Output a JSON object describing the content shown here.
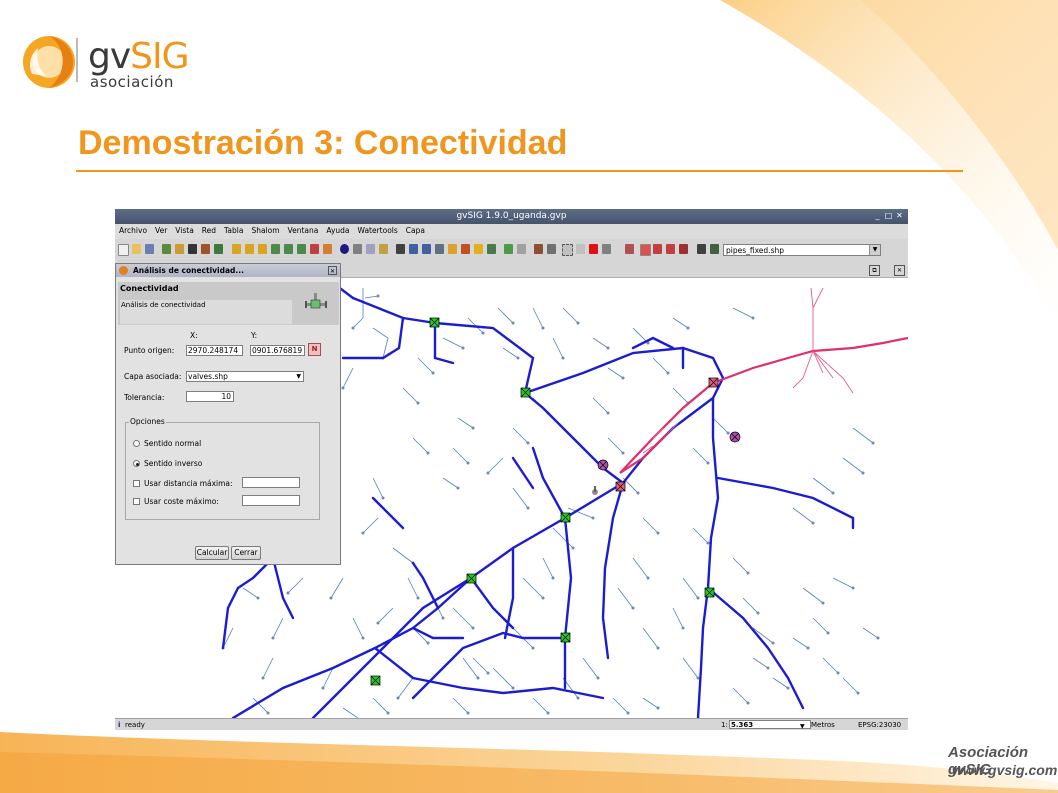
{
  "slide": {
    "logo_brand_prefix": "gv",
    "logo_brand_suffix": "SIG",
    "logo_subtitle": "asociación",
    "title": "Demostración 3: Conectividad",
    "footer_org": "Asociación gvSIG",
    "footer_url": "www.gvsig.com",
    "colors": {
      "accent": "#f0961e",
      "pipe": "#1c1cd0",
      "selected_pipe": "#e0306a",
      "valve": "#22cc22"
    }
  },
  "app": {
    "window_title": "gvSIG 1.9.0_uganda.gvp",
    "menu": [
      "Archivo",
      "Ver",
      "Vista",
      "Red",
      "Tabla",
      "Shalom",
      "Ventana",
      "Ayuda",
      "Watertools",
      "Capa"
    ],
    "layer_combo_value": "pipes_fixed.shp",
    "status_text": "ready",
    "scale_prefix": "1:",
    "scale_value": "5.363",
    "units": "Metros",
    "crs": "EPSG:23030"
  },
  "dialog": {
    "window_title": "Análisis de conectividad...",
    "header_title": "Conectividad",
    "header_desc": "Análisis de conectividad",
    "x_label": "X:",
    "y_label": "Y:",
    "origin_label": "Punto origen:",
    "origin_x": "2970.248174",
    "origin_y": "0901.676819",
    "layer_label": "Capa asociada:",
    "layer_value": "valves.shp",
    "tolerance_label": "Tolerancia:",
    "tolerance_value": "10",
    "options_title": "Opciones",
    "radio_normal": "Sentido normal",
    "radio_inverse": "Sentido inverso",
    "check_distance": "Usar distancia máxima:",
    "check_cost": "Usar coste máximo:",
    "calc_button": "Calcular",
    "close_button": "Cerrar",
    "selected_direction": "inverse"
  }
}
